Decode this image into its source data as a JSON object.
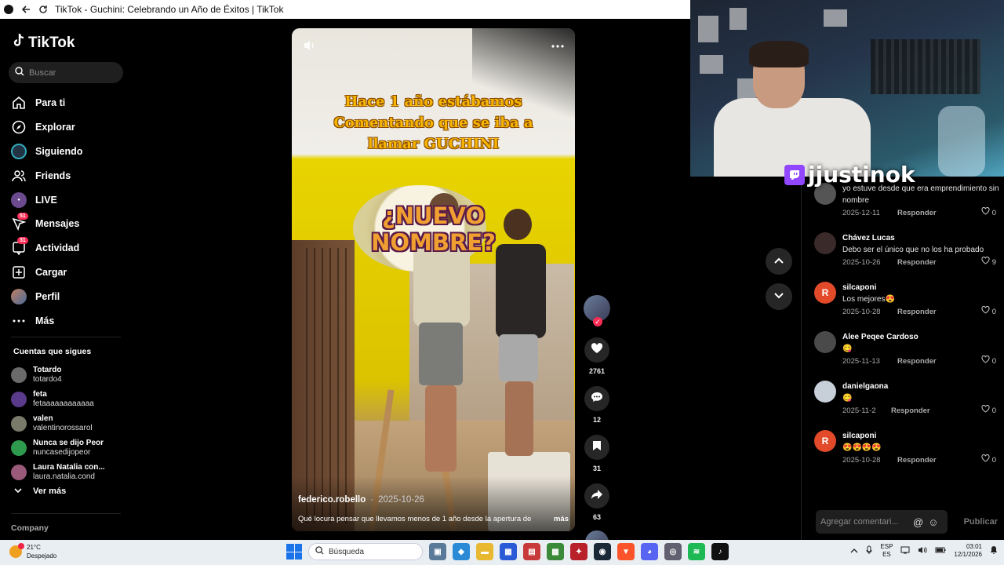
{
  "browser": {
    "title": "TikTok - Guchini: Celebrando un Año de Éxitos | TikTok"
  },
  "sidebar": {
    "logo_text": "TikTok",
    "search_placeholder": "Buscar",
    "nav": [
      {
        "label": "Para ti",
        "icon": "home-icon"
      },
      {
        "label": "Explorar",
        "icon": "compass-icon"
      },
      {
        "label": "Siguiendo",
        "icon": "following-avatar-icon"
      },
      {
        "label": "Friends",
        "icon": "friends-icon"
      },
      {
        "label": "LIVE",
        "icon": "live-icon"
      },
      {
        "label": "Mensajes",
        "icon": "messages-icon",
        "badge": "51"
      },
      {
        "label": "Actividad",
        "icon": "activity-icon",
        "badge": "31"
      },
      {
        "label": "Cargar",
        "icon": "upload-icon"
      },
      {
        "label": "Perfil",
        "icon": "profile-avatar-icon"
      },
      {
        "label": "Más",
        "icon": "more-icon"
      }
    ],
    "following_title": "Cuentas que sigues",
    "following": [
      {
        "name": "Totardo",
        "handle": "totardo4",
        "color": "#6a6a6a"
      },
      {
        "name": "feta",
        "handle": "fetaaaaaaaaaaaa",
        "color": "#5a3a8a"
      },
      {
        "name": "valen",
        "handle": "valentinorossarol",
        "color": "#7a7a6a"
      },
      {
        "name": "Nunca se dijo Peor",
        "handle": "nuncasedijopeor",
        "color": "#2e9a4e"
      },
      {
        "name": "Laura Natalia con...",
        "handle": "laura.natalia.cond",
        "color": "#9a5a7a"
      }
    ],
    "see_more": "Ver más",
    "company": "Company"
  },
  "video": {
    "overlay_text_top": [
      "Hace 1 año estábamos",
      "Comentando que se iba a",
      "llamar GUCHINI"
    ],
    "overlay_text_big": [
      "¿NUEVO",
      "NOMBRE?"
    ],
    "author": "federico.robello",
    "date": "2025-10-26",
    "caption": "Qué locura pensar que llevamos menos de 1 año desde la apertura de",
    "caption_more": "más"
  },
  "actions": {
    "likes": "2761",
    "comments": "12",
    "saves": "31",
    "shares": "63"
  },
  "streamer": {
    "name": "jjustinok"
  },
  "comments": {
    "items": [
      {
        "user": "",
        "text": "yo estuve desde que era emprendimiento sin nombre",
        "date": "2025-12-11",
        "reply": "Responder",
        "likes": "0",
        "avatar_letter": "",
        "avatar_color": "#555"
      },
      {
        "user": "Chávez Lucas",
        "text": "Debo ser el único que no los ha probado",
        "date": "2025-10-26",
        "reply": "Responder",
        "likes": "9",
        "avatar_letter": "",
        "avatar_color": "#3a2a2a"
      },
      {
        "user": "silcaponi",
        "text": "Los mejores😍",
        "date": "2025-10-28",
        "reply": "Responder",
        "likes": "0",
        "avatar_letter": "R",
        "avatar_color": "#e24a2a"
      },
      {
        "user": "Alee Peqee Cardoso",
        "text": "😋",
        "date": "2025-11-13",
        "reply": "Responder",
        "likes": "0",
        "avatar_letter": "",
        "avatar_color": "#4a4a4a"
      },
      {
        "user": "danielgaona",
        "text": "😋",
        "date": "2025-11-2",
        "reply": "Responder",
        "likes": "0",
        "avatar_letter": "",
        "avatar_color": "#c7cfd8"
      },
      {
        "user": "silcaponi",
        "text": "😍😍😍😍",
        "date": "2025-10-28",
        "reply": "Responder",
        "likes": "0",
        "avatar_letter": "R",
        "avatar_color": "#e24a2a"
      }
    ],
    "input_placeholder": "Agregar comentari...",
    "post_label": "Publicar"
  },
  "taskbar": {
    "weather_temp": "21°C",
    "weather_desc": "Despejado",
    "search_placeholder": "Búsqueda",
    "lang_top": "ESP",
    "lang_bottom": "ES",
    "time": "03:01",
    "date": "12/1/2026"
  }
}
